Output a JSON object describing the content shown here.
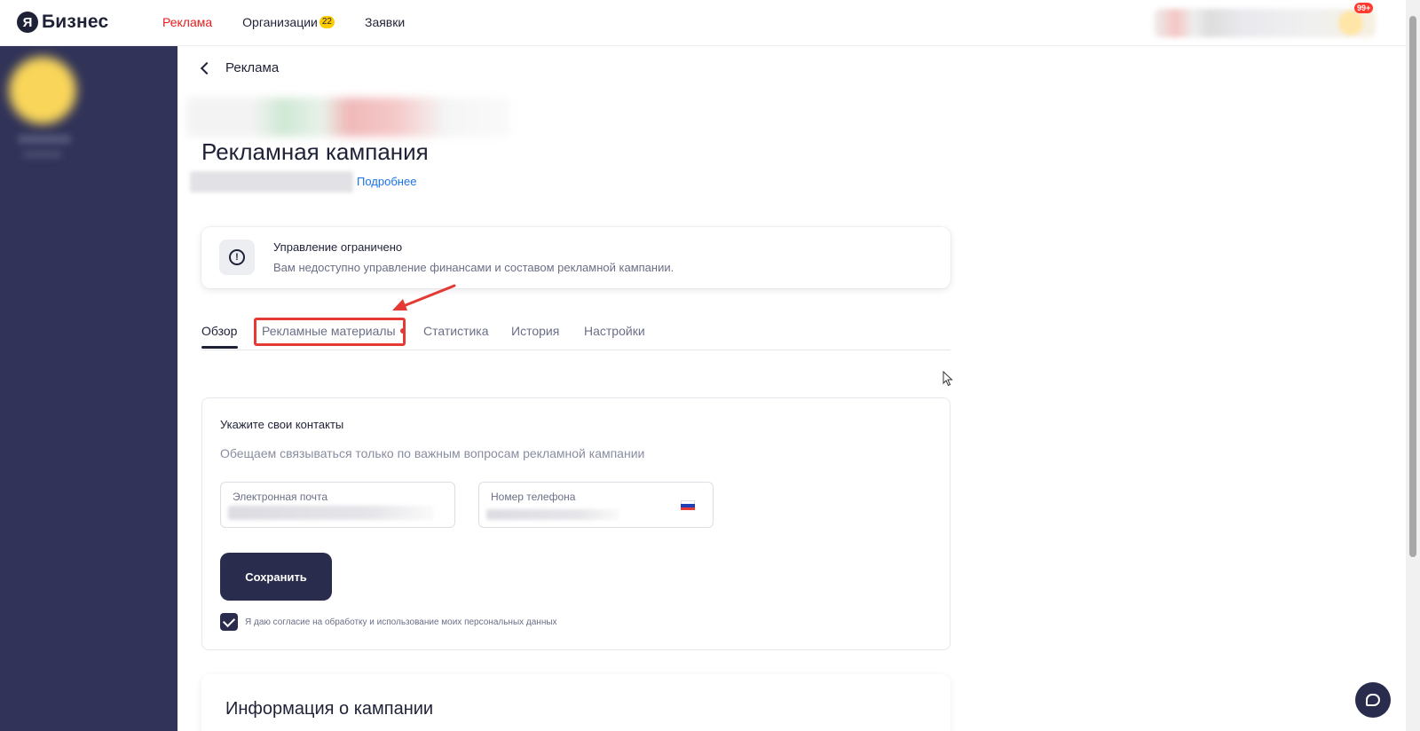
{
  "brand": {
    "logo_letter": "Я",
    "name": "Бизнес"
  },
  "nav": {
    "items": [
      {
        "label": "Реклама",
        "active": true
      },
      {
        "label": "Организации",
        "badge": "22"
      },
      {
        "label": "Заявки"
      }
    ]
  },
  "top_right": {
    "notification_badge": "99+"
  },
  "back": {
    "label": "Реклама"
  },
  "page": {
    "title": "Рекламная кампания",
    "more_link": "Подробнее"
  },
  "notice": {
    "icon": "exclamation-circle-icon",
    "title": "Управление ограничено",
    "text": "Вам недоступно управление финансами и составом рекламной кампании."
  },
  "tabs": [
    {
      "label": "Обзор",
      "active": true
    },
    {
      "label": "Рекламные материалы",
      "has_dot": true,
      "highlighted": true
    },
    {
      "label": "Статистика"
    },
    {
      "label": "История"
    },
    {
      "label": "Настройки"
    }
  ],
  "contacts": {
    "title": "Укажите свои контакты",
    "subtitle": "Обещаем связываться только по важным вопросам рекламной кампании",
    "email_label": "Электронная почта",
    "phone_label": "Номер телефона",
    "save_label": "Сохранить",
    "consent_text": "Я даю согласие на обработку и использование моих персональных данных",
    "consent_checked": true
  },
  "info": {
    "title": "Информация о кампании"
  },
  "colors": {
    "accent_red": "#e31d1d",
    "sidebar": "#313358",
    "primary_button": "#2a2c4e",
    "link": "#1a73e8"
  }
}
